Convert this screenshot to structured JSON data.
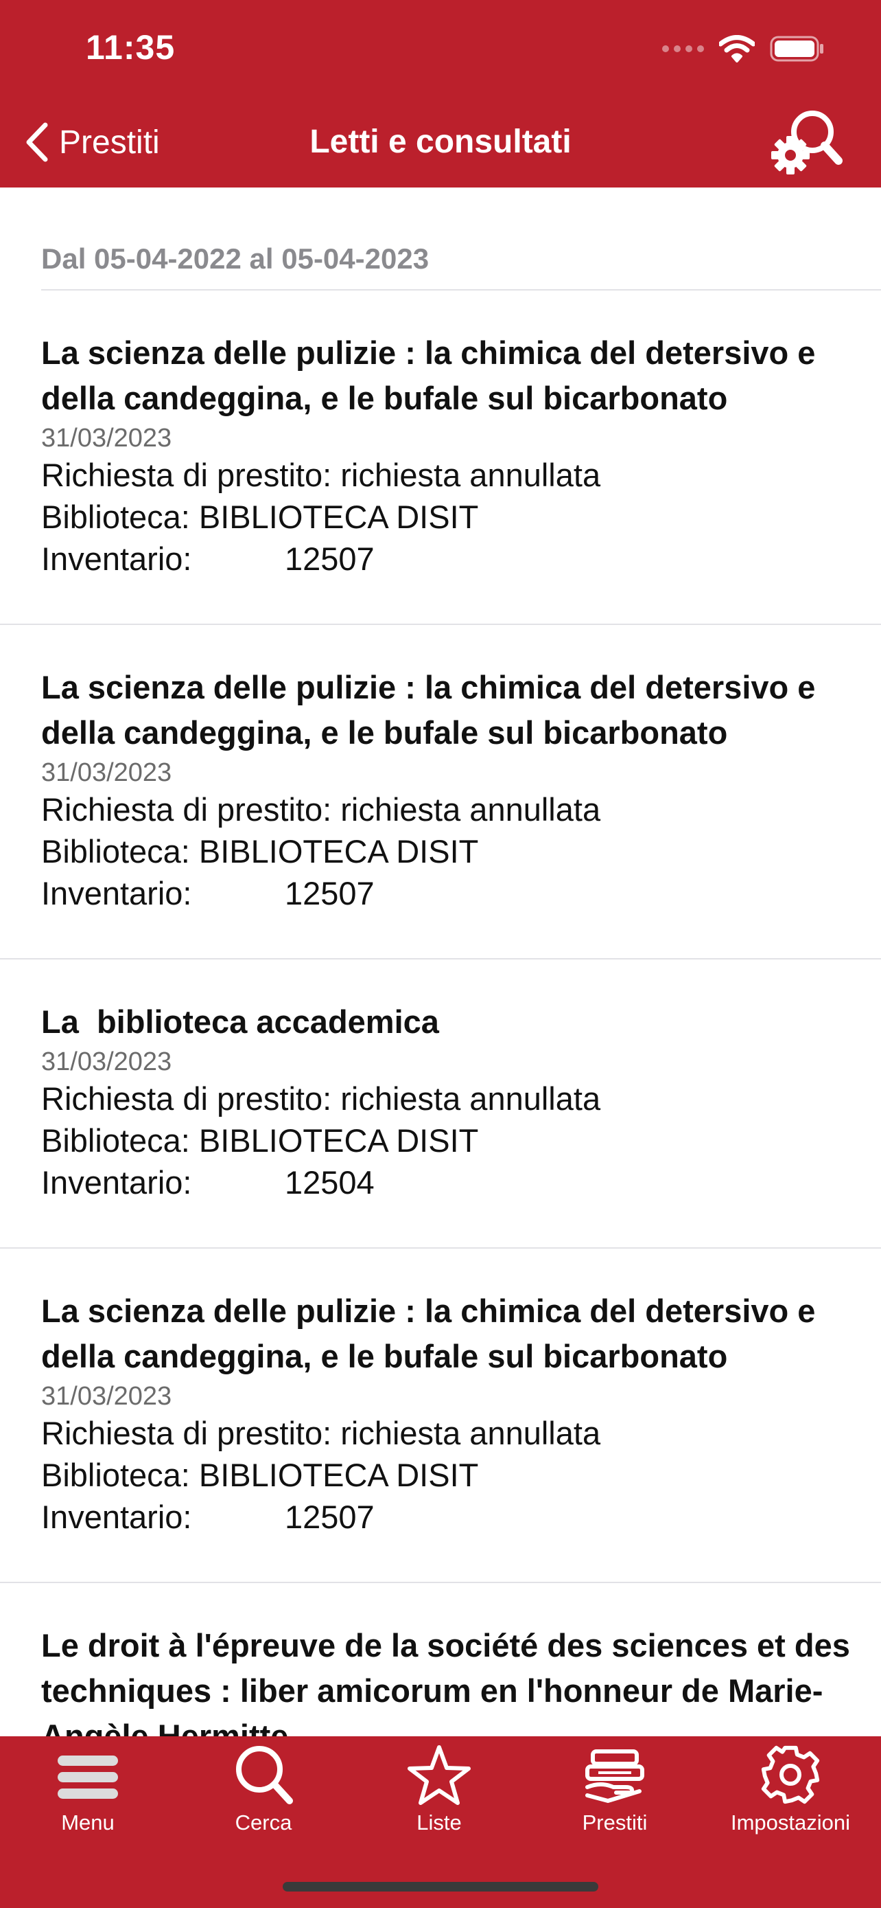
{
  "status_bar": {
    "time": "11:35"
  },
  "nav": {
    "back_label": "Prestiti",
    "title": "Letti e consultati",
    "action_icon": "search-settings-icon"
  },
  "date_range": "Dal 05-04-2022 al 05-04-2023",
  "items": [
    {
      "title": "La scienza delle pulizie : la chimica del detersivo e della candeggina, e le bufale sul bicarbonato",
      "date": "31/03/2023",
      "status": "Richiesta di prestito: richiesta annullata",
      "library": "Biblioteca: BIBLIOTECA DISIT",
      "inventory_label": "Inventario:",
      "inventory_value": "12507"
    },
    {
      "title": "La scienza delle pulizie : la chimica del detersivo e della candeggina, e le bufale sul bicarbonato",
      "date": "31/03/2023",
      "status": "Richiesta di prestito: richiesta annullata",
      "library": "Biblioteca: BIBLIOTECA DISIT",
      "inventory_label": "Inventario:",
      "inventory_value": "12507"
    },
    {
      "title": "La  biblioteca accademica",
      "date": "31/03/2023",
      "status": "Richiesta di prestito: richiesta annullata",
      "library": "Biblioteca: BIBLIOTECA DISIT",
      "inventory_label": "Inventario:",
      "inventory_value": "12504"
    },
    {
      "title": "La scienza delle pulizie : la chimica del detersivo e della candeggina, e le bufale sul bicarbonato",
      "date": "31/03/2023",
      "status": "Richiesta di prestito: richiesta annullata",
      "library": "Biblioteca: BIBLIOTECA DISIT",
      "inventory_label": "Inventario:",
      "inventory_value": "12507"
    },
    {
      "title": "Le droit à l'épreuve de la société des sciences et des techniques : liber amicorum en l'honneur de Marie-Angèle Hermitte",
      "date": "",
      "status": "",
      "library": "",
      "inventory_label": "",
      "inventory_value": ""
    }
  ],
  "tabs": [
    {
      "label": "Menu",
      "icon": "menu-icon"
    },
    {
      "label": "Cerca",
      "icon": "search-icon"
    },
    {
      "label": "Liste",
      "icon": "star-icon"
    },
    {
      "label": "Prestiti",
      "icon": "books-icon"
    },
    {
      "label": "Impostazioni",
      "icon": "gear-icon"
    }
  ],
  "colors": {
    "brand": "#bb202c",
    "secondary_text": "#8a8a8e",
    "separator": "#e2e2e6"
  }
}
